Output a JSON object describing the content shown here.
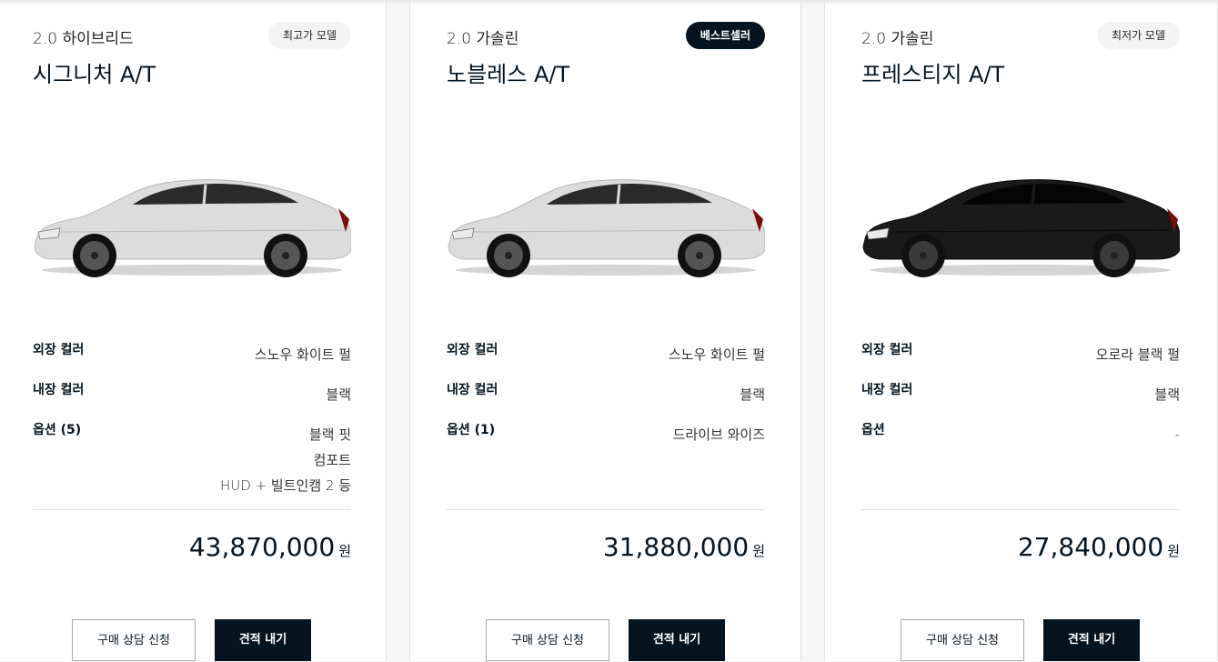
{
  "cards": [
    {
      "engine": "2.0 하이브리드",
      "trim": "시그니처 A/T",
      "badge": "최고가 모델",
      "car_color": "white",
      "specs": [
        {
          "label": "외장 컬러",
          "value": "스노우 화이트 펄"
        },
        {
          "label": "내장 컬러",
          "value": "블랙"
        },
        {
          "label": "옵션 (5)",
          "values": [
            "블랙 핏",
            "컴포트",
            "HUD + 빌트인캠 2 등"
          ]
        }
      ],
      "price": "43,870,000",
      "unit": "원",
      "consult_label": "구매 상담 신청",
      "quote_label": "견적 내기"
    },
    {
      "engine": "2.0 가솔린",
      "trim": "노블레스 A/T",
      "badge": "베스트셀러",
      "car_color": "white",
      "specs": [
        {
          "label": "외장 컬러",
          "value": "스노우 화이트 펄"
        },
        {
          "label": "내장 컬러",
          "value": "블랙"
        },
        {
          "label": "옵션 (1)",
          "values": [
            "드라이브 와이즈"
          ]
        }
      ],
      "price": "31,880,000",
      "unit": "원",
      "consult_label": "구매 상담 신청",
      "quote_label": "견적 내기"
    },
    {
      "engine": "2.0 가솔린",
      "trim": "프레스티지 A/T",
      "badge": "최저가 모델",
      "car_color": "black",
      "specs": [
        {
          "label": "외장 컬러",
          "value": "오로라 블랙 펄"
        },
        {
          "label": "내장 컬러",
          "value": "블랙"
        },
        {
          "label": "옵션",
          "values": [
            "-"
          ]
        }
      ],
      "price": "27,840,000",
      "unit": "원",
      "consult_label": "구매 상담 신청",
      "quote_label": "견적 내기"
    }
  ],
  "colors": {
    "accent": "#05141f",
    "badge_light": "#f3f3f3",
    "car_white": "#dcdcdc",
    "car_black": "#1a1a1a"
  }
}
